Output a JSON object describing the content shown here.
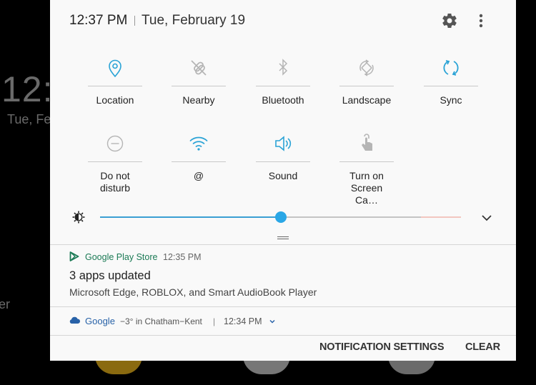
{
  "background": {
    "clock_partial": "12:",
    "date_partial": "Tue, Fe",
    "label_partial": "er"
  },
  "header": {
    "time": "12:37 PM",
    "date": "Tue, February 19",
    "settings_icon": "gear-icon",
    "more_icon": "more-vert-icon"
  },
  "quick_settings": {
    "active_color": "#2aa3d6",
    "inactive_color": "#b5b5b5",
    "tiles": [
      {
        "label": "Location",
        "icon": "location-pin-icon",
        "active": true
      },
      {
        "label": "Nearby",
        "icon": "nearby-share-icon",
        "active": false
      },
      {
        "label": "Bluetooth",
        "icon": "bluetooth-icon",
        "active": false
      },
      {
        "label": "Landscape",
        "icon": "rotation-icon",
        "active": false
      },
      {
        "label": "Sync",
        "icon": "sync-icon",
        "active": true
      },
      {
        "label": "Do not disturb",
        "icon": "do-not-disturb-icon",
        "active": false
      },
      {
        "label": "@",
        "icon": "wifi-icon",
        "active": true
      },
      {
        "label": "Sound",
        "icon": "speaker-icon",
        "active": true
      },
      {
        "label": "Turn on Screen Ca…",
        "icon": "touch-icon",
        "active": false
      }
    ]
  },
  "brightness": {
    "icon": "brightness-icon",
    "level_fraction": 0.5,
    "expand_icon": "chevron-down-icon"
  },
  "notifications": [
    {
      "app": "Google Play Store",
      "app_color": "#1b7a55",
      "time": "12:35 PM",
      "title": "3 apps updated",
      "body": "Microsoft Edge, ROBLOX, and Smart AudioBook Player"
    }
  ],
  "weather": {
    "app": "Google",
    "app_color": "#2862a8",
    "info": "−3° in Chatham−Kent",
    "separator": "|",
    "time": "12:34 PM"
  },
  "footer": {
    "notification_settings": "NOTIFICATION SETTINGS",
    "clear": "CLEAR"
  }
}
